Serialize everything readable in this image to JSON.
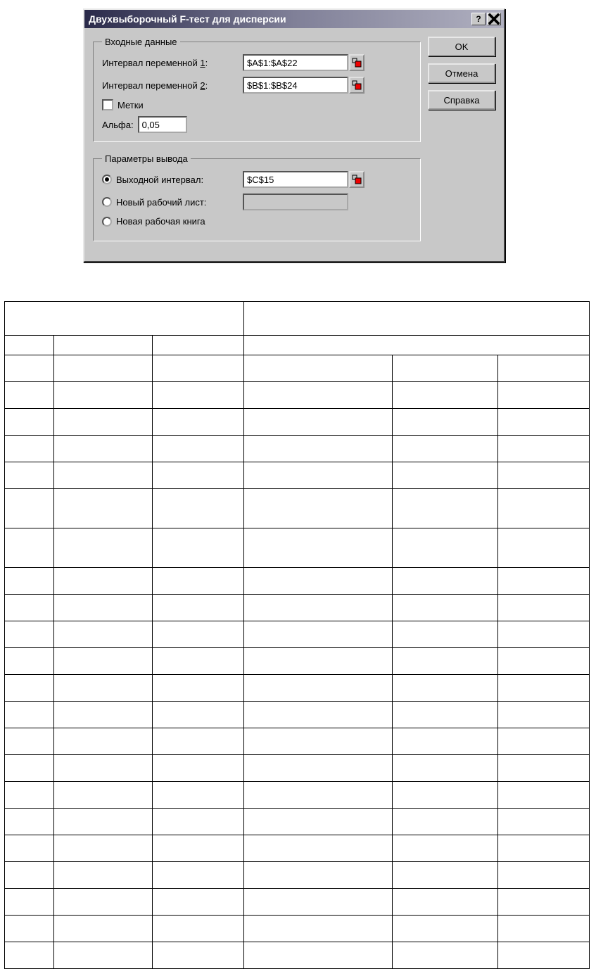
{
  "dialog": {
    "title": "Двухвыборочный F-тест для дисперсии",
    "buttons": {
      "ok": "OK",
      "cancel": "Отмена",
      "help": "Справка"
    },
    "input_group": {
      "legend": "Входные данные",
      "var1_label_pre": "Интервал переменной ",
      "var1_num": "1",
      "var1_colon": ":",
      "var1_value": "$A$1:$A$22",
      "var2_label_pre": "Интервал переменной ",
      "var2_num": "2",
      "var2_colon": ":",
      "var2_value": "$B$1:$B$24",
      "labels_checkbox": "Метки",
      "alpha_label": "Альфа:",
      "alpha_value": "0,05"
    },
    "output_group": {
      "legend": "Параметры вывода",
      "opt_output_range": "Выходной интервал:",
      "output_range_value": "$C$15",
      "opt_new_sheet": "Новый рабочий лист:",
      "new_sheet_value": "",
      "opt_new_book": "Новая рабочая книга"
    }
  },
  "table": {
    "rows": 24
  }
}
